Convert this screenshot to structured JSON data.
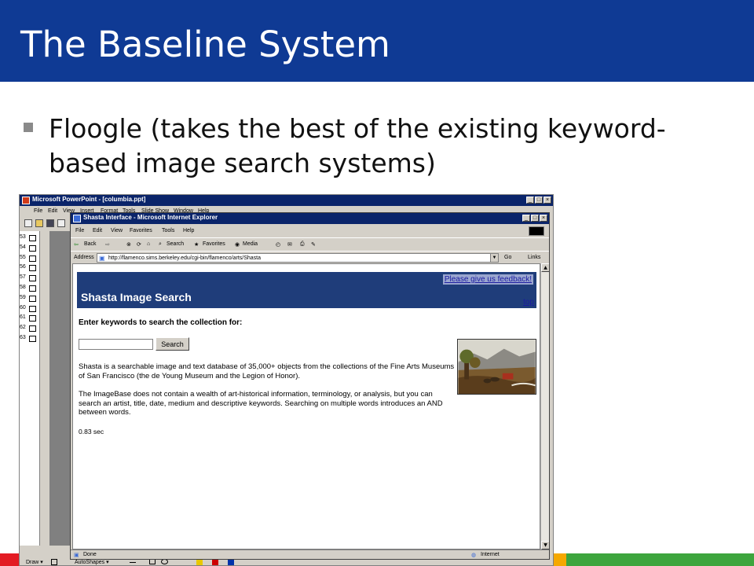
{
  "slide": {
    "title": "The Baseline System",
    "bullet": "Floogle (takes the best of the existing keyword-based image search systems)",
    "strip_colors": [
      "#e31b23",
      "#f5a800",
      "#3da53d"
    ]
  },
  "ppt": {
    "title": "Microsoft PowerPoint - [columbia.ppt]",
    "menu": [
      "File",
      "Edit",
      "View",
      "Insert",
      "Format",
      "Tools",
      "Slide Show",
      "Window",
      "Help"
    ],
    "slide_numbers": [
      "53",
      "54",
      "55",
      "56",
      "57",
      "58",
      "59",
      "60",
      "61",
      "62",
      "63"
    ],
    "draw_bar": {
      "draw": "Draw ▾",
      "autoshapes": "AutoShapes ▾"
    }
  },
  "ie": {
    "title": "Shasta Interface - Microsoft Internet Explorer",
    "menu": [
      "File",
      "Edit",
      "View",
      "Favorites",
      "Tools",
      "Help"
    ],
    "toolbar": {
      "back": "Back",
      "search": "Search",
      "favorites": "Favorites",
      "media": "Media"
    },
    "address_label": "Address",
    "address_url": "http://flamenco.sims.berkeley.edu/cgi-bin/flamenco/arts/Shasta",
    "go": "Go",
    "links": "Links",
    "status_left": "Done",
    "status_right": "Internet"
  },
  "page": {
    "banner_title": "Shasta Image Search",
    "feedback_link": "Please give us feedback!",
    "top_link": "top",
    "prompt": "Enter keywords to search the collection for:",
    "search_value": "",
    "search_button": "Search",
    "para1": "Shasta is a searchable image and text database of 35,000+ objects from the collections of the Fine Arts Museums of San Francisco (the de Young Museum and the Legion of Honor).",
    "para2": "The ImageBase does not contain a wealth of art-historical information, terminology, or analysis, but you can search an artist, title, date, medium and descriptive keywords. Searching on multiple words introduces an AND between words.",
    "timing": "0.83 sec"
  },
  "colors": {
    "title_bar": "#0f3a94",
    "titlebar_win": "#0a246a",
    "banner": "#1f3d7a",
    "window_face": "#d4d0c8"
  }
}
